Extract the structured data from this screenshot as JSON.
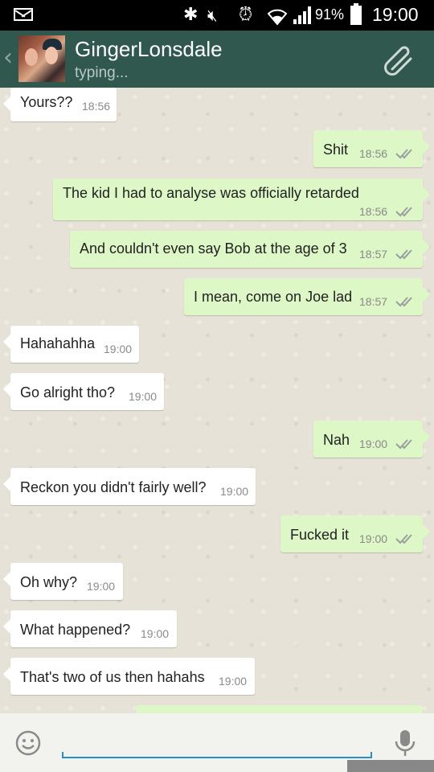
{
  "status_bar": {
    "battery": "91%",
    "time": "19:00",
    "icons": [
      "mail-icon",
      "bluetooth-icon",
      "mute-icon",
      "alarm-icon",
      "wifi-icon",
      "signal-icon",
      "battery-icon"
    ]
  },
  "header": {
    "contact_name": "GingerLonsdale",
    "status": "typing...",
    "icons": [
      "back-chevron-icon",
      "avatar",
      "paperclip-icon"
    ]
  },
  "messages": [
    {
      "dir": "in",
      "text": "Yours??",
      "time": "18:56"
    },
    {
      "dir": "out",
      "text": "Shit",
      "time": "18:56",
      "ticks": true
    },
    {
      "dir": "out",
      "text": "The kid I had to analyse was officially retarded",
      "time": "18:56",
      "ticks": true
    },
    {
      "dir": "out",
      "text": "And couldn't even say Bob at the age of 3",
      "time": "18:57",
      "ticks": true
    },
    {
      "dir": "out",
      "text": "I mean, come on Joe lad",
      "time": "18:57",
      "ticks": true
    },
    {
      "dir": "in",
      "text": "Hahahahha",
      "time": "19:00"
    },
    {
      "dir": "in",
      "text": "Go alright tho?",
      "time": "19:00"
    },
    {
      "dir": "out",
      "text": "Nah",
      "time": "19:00",
      "ticks": true
    },
    {
      "dir": "in",
      "text": "Reckon you didn't fairly well?",
      "time": "19:00"
    },
    {
      "dir": "out",
      "text": "Fucked it",
      "time": "19:00",
      "ticks": true
    },
    {
      "dir": "in",
      "text": "Oh why?",
      "time": "19:00"
    },
    {
      "dir": "in",
      "text": "What happened?",
      "time": "19:00"
    },
    {
      "dir": "in",
      "text": "That's two of us then hahahs",
      "time": "19:00"
    }
  ],
  "composer": {
    "value": "",
    "icons": [
      "emoji-icon",
      "microphone-icon"
    ]
  },
  "colors": {
    "action_bar": "#30584f",
    "incoming_bubble": "#ffffff",
    "outgoing_bubble": "#ddf7c6",
    "chat_background": "#e6e2d7",
    "input_underline": "#2a8fc8"
  }
}
